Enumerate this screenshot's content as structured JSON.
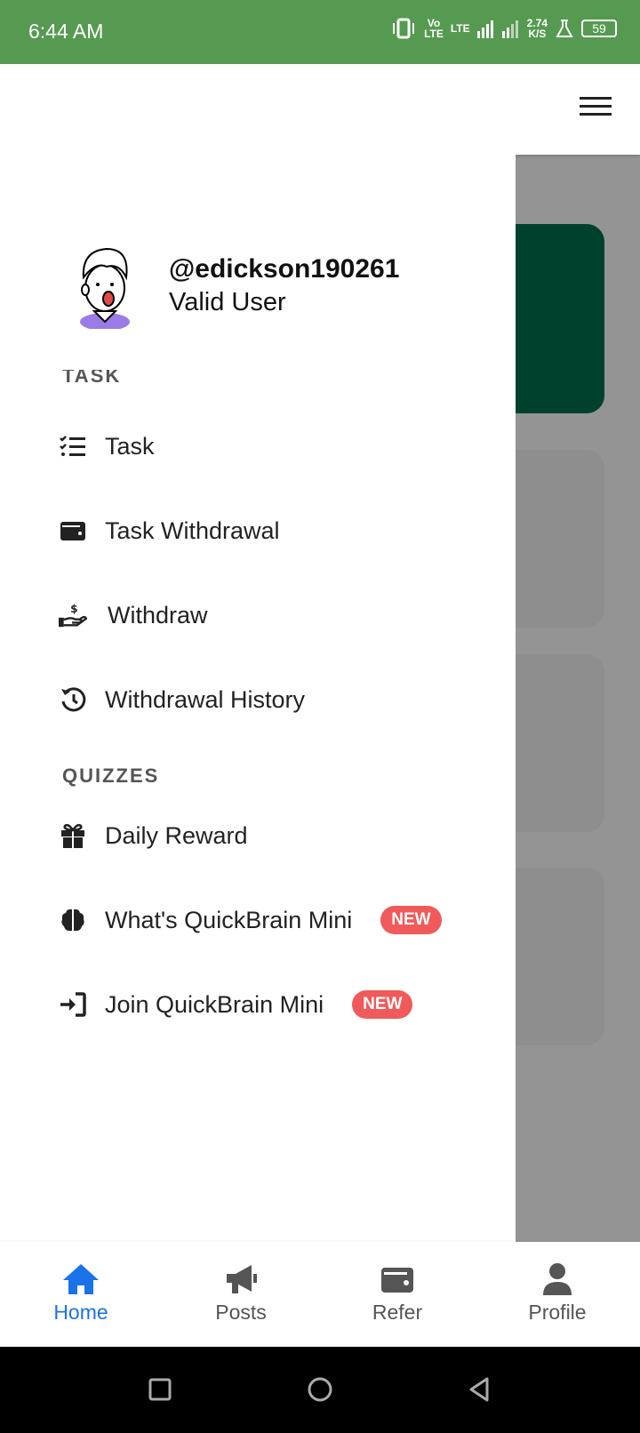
{
  "status_bar": {
    "time": "6:44 AM",
    "network_1": "Vo\nLTE",
    "network_2": "LTE",
    "speed": "2.74\nK/S",
    "battery": "59"
  },
  "drawer": {
    "username": "@edickson190261",
    "user_status": "Valid User",
    "sections": {
      "task": "TASK",
      "quizzes": "QUIZZES"
    },
    "items": {
      "task": "Task",
      "task_withdrawal": "Task Withdrawal",
      "withdraw": "Withdraw",
      "withdrawal_history": "Withdrawal History",
      "daily_reward": "Daily Reward",
      "whats_quickbrain": "What's QuickBrain Mini",
      "join_quickbrain": "Join QuickBrain Mini"
    },
    "badge_new": "NEW",
    "badge_color": "#f05a5a"
  },
  "bottom_nav": {
    "home": "Home",
    "posts": "Posts",
    "refer": "Refer",
    "profile": "Profile",
    "active_color": "#1a73e8"
  },
  "colors": {
    "status_bar": "#559a50",
    "banner": "#01704f"
  }
}
